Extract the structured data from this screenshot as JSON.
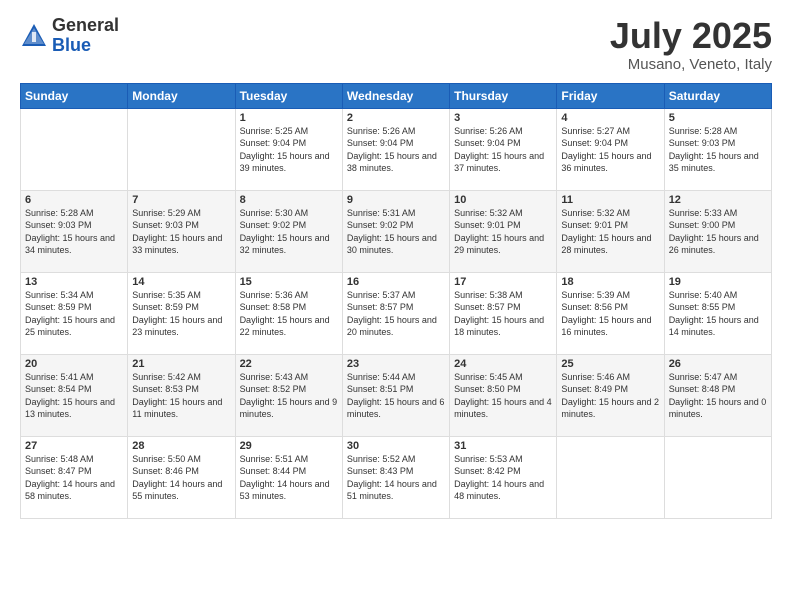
{
  "logo": {
    "general": "General",
    "blue": "Blue"
  },
  "title": "July 2025",
  "subtitle": "Musano, Veneto, Italy",
  "days_of_week": [
    "Sunday",
    "Monday",
    "Tuesday",
    "Wednesday",
    "Thursday",
    "Friday",
    "Saturday"
  ],
  "weeks": [
    [
      {
        "day": "",
        "sunrise": "",
        "sunset": "",
        "daylight": ""
      },
      {
        "day": "",
        "sunrise": "",
        "sunset": "",
        "daylight": ""
      },
      {
        "day": "1",
        "sunrise": "Sunrise: 5:25 AM",
        "sunset": "Sunset: 9:04 PM",
        "daylight": "Daylight: 15 hours and 39 minutes."
      },
      {
        "day": "2",
        "sunrise": "Sunrise: 5:26 AM",
        "sunset": "Sunset: 9:04 PM",
        "daylight": "Daylight: 15 hours and 38 minutes."
      },
      {
        "day": "3",
        "sunrise": "Sunrise: 5:26 AM",
        "sunset": "Sunset: 9:04 PM",
        "daylight": "Daylight: 15 hours and 37 minutes."
      },
      {
        "day": "4",
        "sunrise": "Sunrise: 5:27 AM",
        "sunset": "Sunset: 9:04 PM",
        "daylight": "Daylight: 15 hours and 36 minutes."
      },
      {
        "day": "5",
        "sunrise": "Sunrise: 5:28 AM",
        "sunset": "Sunset: 9:03 PM",
        "daylight": "Daylight: 15 hours and 35 minutes."
      }
    ],
    [
      {
        "day": "6",
        "sunrise": "Sunrise: 5:28 AM",
        "sunset": "Sunset: 9:03 PM",
        "daylight": "Daylight: 15 hours and 34 minutes."
      },
      {
        "day": "7",
        "sunrise": "Sunrise: 5:29 AM",
        "sunset": "Sunset: 9:03 PM",
        "daylight": "Daylight: 15 hours and 33 minutes."
      },
      {
        "day": "8",
        "sunrise": "Sunrise: 5:30 AM",
        "sunset": "Sunset: 9:02 PM",
        "daylight": "Daylight: 15 hours and 32 minutes."
      },
      {
        "day": "9",
        "sunrise": "Sunrise: 5:31 AM",
        "sunset": "Sunset: 9:02 PM",
        "daylight": "Daylight: 15 hours and 30 minutes."
      },
      {
        "day": "10",
        "sunrise": "Sunrise: 5:32 AM",
        "sunset": "Sunset: 9:01 PM",
        "daylight": "Daylight: 15 hours and 29 minutes."
      },
      {
        "day": "11",
        "sunrise": "Sunrise: 5:32 AM",
        "sunset": "Sunset: 9:01 PM",
        "daylight": "Daylight: 15 hours and 28 minutes."
      },
      {
        "day": "12",
        "sunrise": "Sunrise: 5:33 AM",
        "sunset": "Sunset: 9:00 PM",
        "daylight": "Daylight: 15 hours and 26 minutes."
      }
    ],
    [
      {
        "day": "13",
        "sunrise": "Sunrise: 5:34 AM",
        "sunset": "Sunset: 8:59 PM",
        "daylight": "Daylight: 15 hours and 25 minutes."
      },
      {
        "day": "14",
        "sunrise": "Sunrise: 5:35 AM",
        "sunset": "Sunset: 8:59 PM",
        "daylight": "Daylight: 15 hours and 23 minutes."
      },
      {
        "day": "15",
        "sunrise": "Sunrise: 5:36 AM",
        "sunset": "Sunset: 8:58 PM",
        "daylight": "Daylight: 15 hours and 22 minutes."
      },
      {
        "day": "16",
        "sunrise": "Sunrise: 5:37 AM",
        "sunset": "Sunset: 8:57 PM",
        "daylight": "Daylight: 15 hours and 20 minutes."
      },
      {
        "day": "17",
        "sunrise": "Sunrise: 5:38 AM",
        "sunset": "Sunset: 8:57 PM",
        "daylight": "Daylight: 15 hours and 18 minutes."
      },
      {
        "day": "18",
        "sunrise": "Sunrise: 5:39 AM",
        "sunset": "Sunset: 8:56 PM",
        "daylight": "Daylight: 15 hours and 16 minutes."
      },
      {
        "day": "19",
        "sunrise": "Sunrise: 5:40 AM",
        "sunset": "Sunset: 8:55 PM",
        "daylight": "Daylight: 15 hours and 14 minutes."
      }
    ],
    [
      {
        "day": "20",
        "sunrise": "Sunrise: 5:41 AM",
        "sunset": "Sunset: 8:54 PM",
        "daylight": "Daylight: 15 hours and 13 minutes."
      },
      {
        "day": "21",
        "sunrise": "Sunrise: 5:42 AM",
        "sunset": "Sunset: 8:53 PM",
        "daylight": "Daylight: 15 hours and 11 minutes."
      },
      {
        "day": "22",
        "sunrise": "Sunrise: 5:43 AM",
        "sunset": "Sunset: 8:52 PM",
        "daylight": "Daylight: 15 hours and 9 minutes."
      },
      {
        "day": "23",
        "sunrise": "Sunrise: 5:44 AM",
        "sunset": "Sunset: 8:51 PM",
        "daylight": "Daylight: 15 hours and 6 minutes."
      },
      {
        "day": "24",
        "sunrise": "Sunrise: 5:45 AM",
        "sunset": "Sunset: 8:50 PM",
        "daylight": "Daylight: 15 hours and 4 minutes."
      },
      {
        "day": "25",
        "sunrise": "Sunrise: 5:46 AM",
        "sunset": "Sunset: 8:49 PM",
        "daylight": "Daylight: 15 hours and 2 minutes."
      },
      {
        "day": "26",
        "sunrise": "Sunrise: 5:47 AM",
        "sunset": "Sunset: 8:48 PM",
        "daylight": "Daylight: 15 hours and 0 minutes."
      }
    ],
    [
      {
        "day": "27",
        "sunrise": "Sunrise: 5:48 AM",
        "sunset": "Sunset: 8:47 PM",
        "daylight": "Daylight: 14 hours and 58 minutes."
      },
      {
        "day": "28",
        "sunrise": "Sunrise: 5:50 AM",
        "sunset": "Sunset: 8:46 PM",
        "daylight": "Daylight: 14 hours and 55 minutes."
      },
      {
        "day": "29",
        "sunrise": "Sunrise: 5:51 AM",
        "sunset": "Sunset: 8:44 PM",
        "daylight": "Daylight: 14 hours and 53 minutes."
      },
      {
        "day": "30",
        "sunrise": "Sunrise: 5:52 AM",
        "sunset": "Sunset: 8:43 PM",
        "daylight": "Daylight: 14 hours and 51 minutes."
      },
      {
        "day": "31",
        "sunrise": "Sunrise: 5:53 AM",
        "sunset": "Sunset: 8:42 PM",
        "daylight": "Daylight: 14 hours and 48 minutes."
      },
      {
        "day": "",
        "sunrise": "",
        "sunset": "",
        "daylight": ""
      },
      {
        "day": "",
        "sunrise": "",
        "sunset": "",
        "daylight": ""
      }
    ]
  ]
}
